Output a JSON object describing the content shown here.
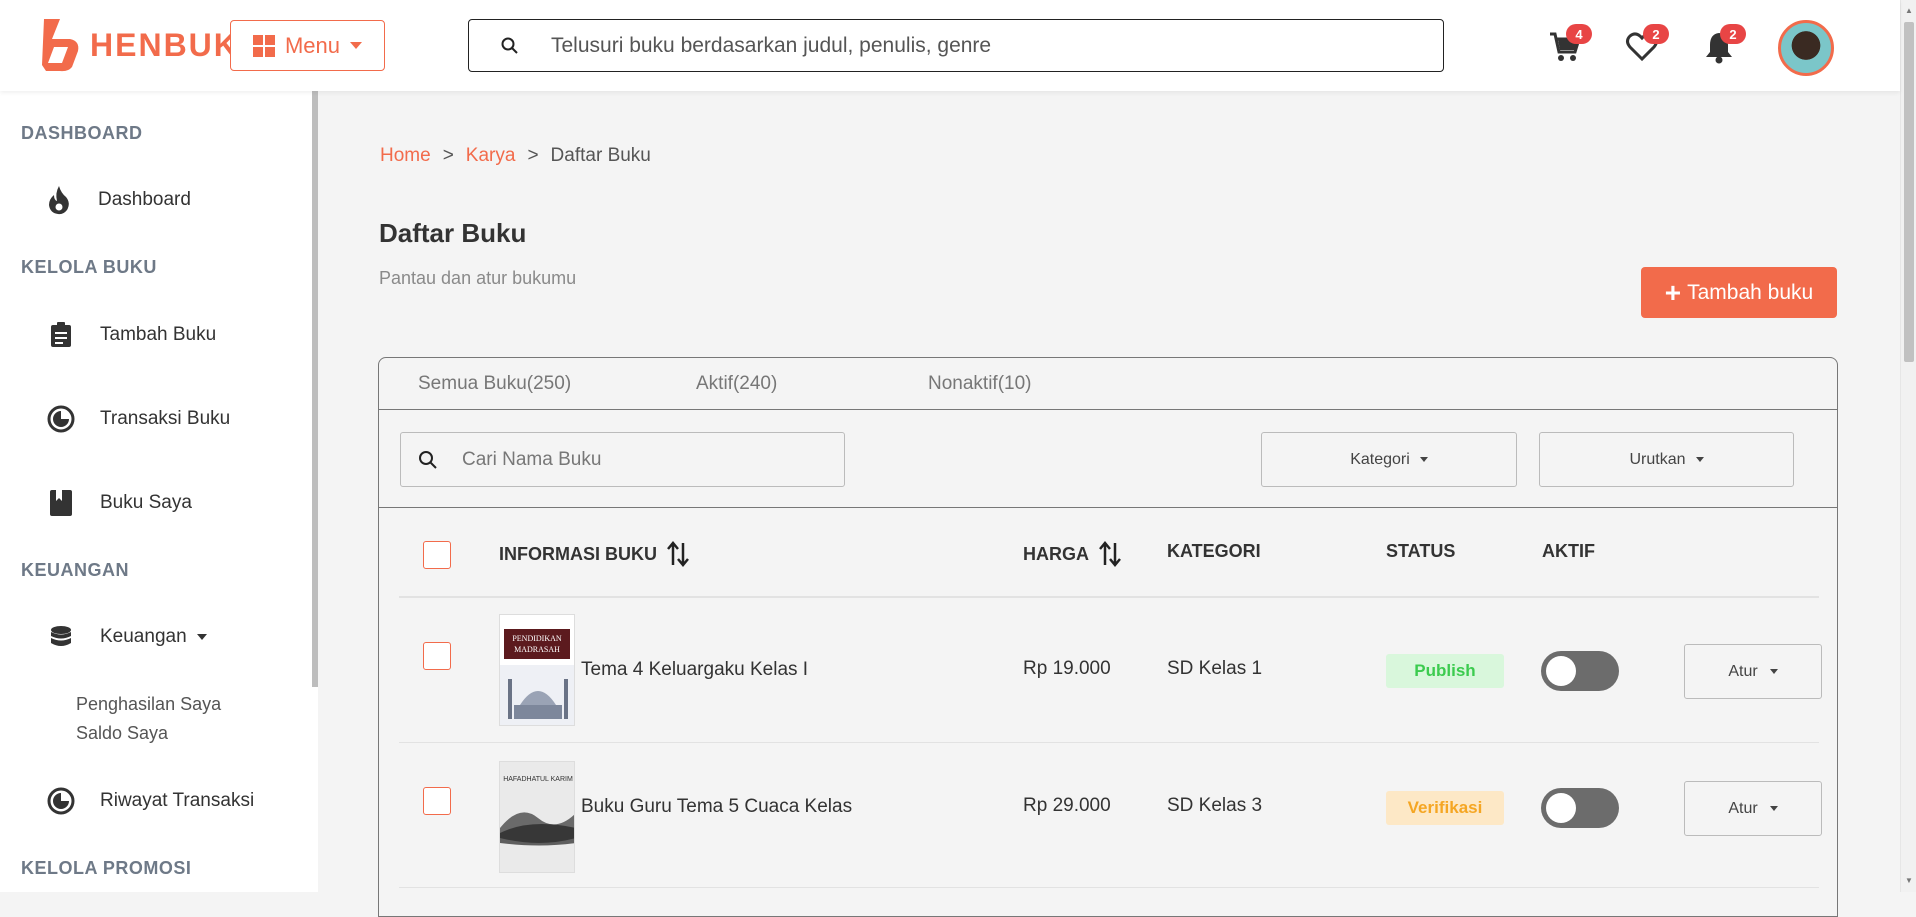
{
  "app": {
    "brand": "HENBUK",
    "menu_label": "Menu",
    "search_placeholder": "Telusuri buku berdasarkan judul, penulis, genre",
    "cart_count": "4",
    "wishlist_count": "2",
    "notif_count": "2",
    "accent": "#f26b4b"
  },
  "sidebar": {
    "sections": {
      "dashboard": "DASHBOARD",
      "kelola_buku": "KELOLA BUKU",
      "keuangan": "KEUANGAN",
      "kelola_promosi": "KELOLA PROMOSI"
    },
    "items": {
      "dashboard": "Dashboard",
      "tambah_buku": "Tambah Buku",
      "transaksi_buku": "Transaksi Buku",
      "buku_saya": "Buku Saya",
      "keuangan": "Keuangan",
      "penghasilan": "Penghasilan Saya",
      "saldo": "Saldo Saya",
      "riwayat": "Riwayat Transaksi"
    }
  },
  "main": {
    "breadcrumb": [
      "Home",
      "Karya",
      "Daftar Buku"
    ],
    "breadcrumb_sep": ">",
    "title": "Daftar Buku",
    "subtitle": "Pantau dan atur bukumu",
    "add_button": "Tambah buku",
    "tabs": [
      "Semua Buku(250)",
      "Aktif(240)",
      "Nonaktif(10)"
    ],
    "search_placeholder": "Cari Nama Buku",
    "filter_kategori": "Kategori",
    "filter_urutkan": "Urutkan",
    "columns": {
      "info": "INFORMASI BUKU",
      "harga": "HARGA",
      "kategori": "KATEGORI",
      "status": "STATUS",
      "aktif": "AKTIF"
    },
    "rows": [
      {
        "title": "Tema 4 Keluargaku Kelas I",
        "price": "Rp 19.000",
        "category": "SD Kelas 1",
        "status": "Publish",
        "action": "Atur",
        "cover_title": "PENDIDIKAN MADRASAH"
      },
      {
        "title": "Buku Guru Tema 5 Cuaca Kelas",
        "price": "Rp 29.000",
        "category": "SD Kelas 3",
        "status": "Verifikasi",
        "action": "Atur",
        "cover_title": "HAFADHATUL KARIM"
      }
    ]
  }
}
